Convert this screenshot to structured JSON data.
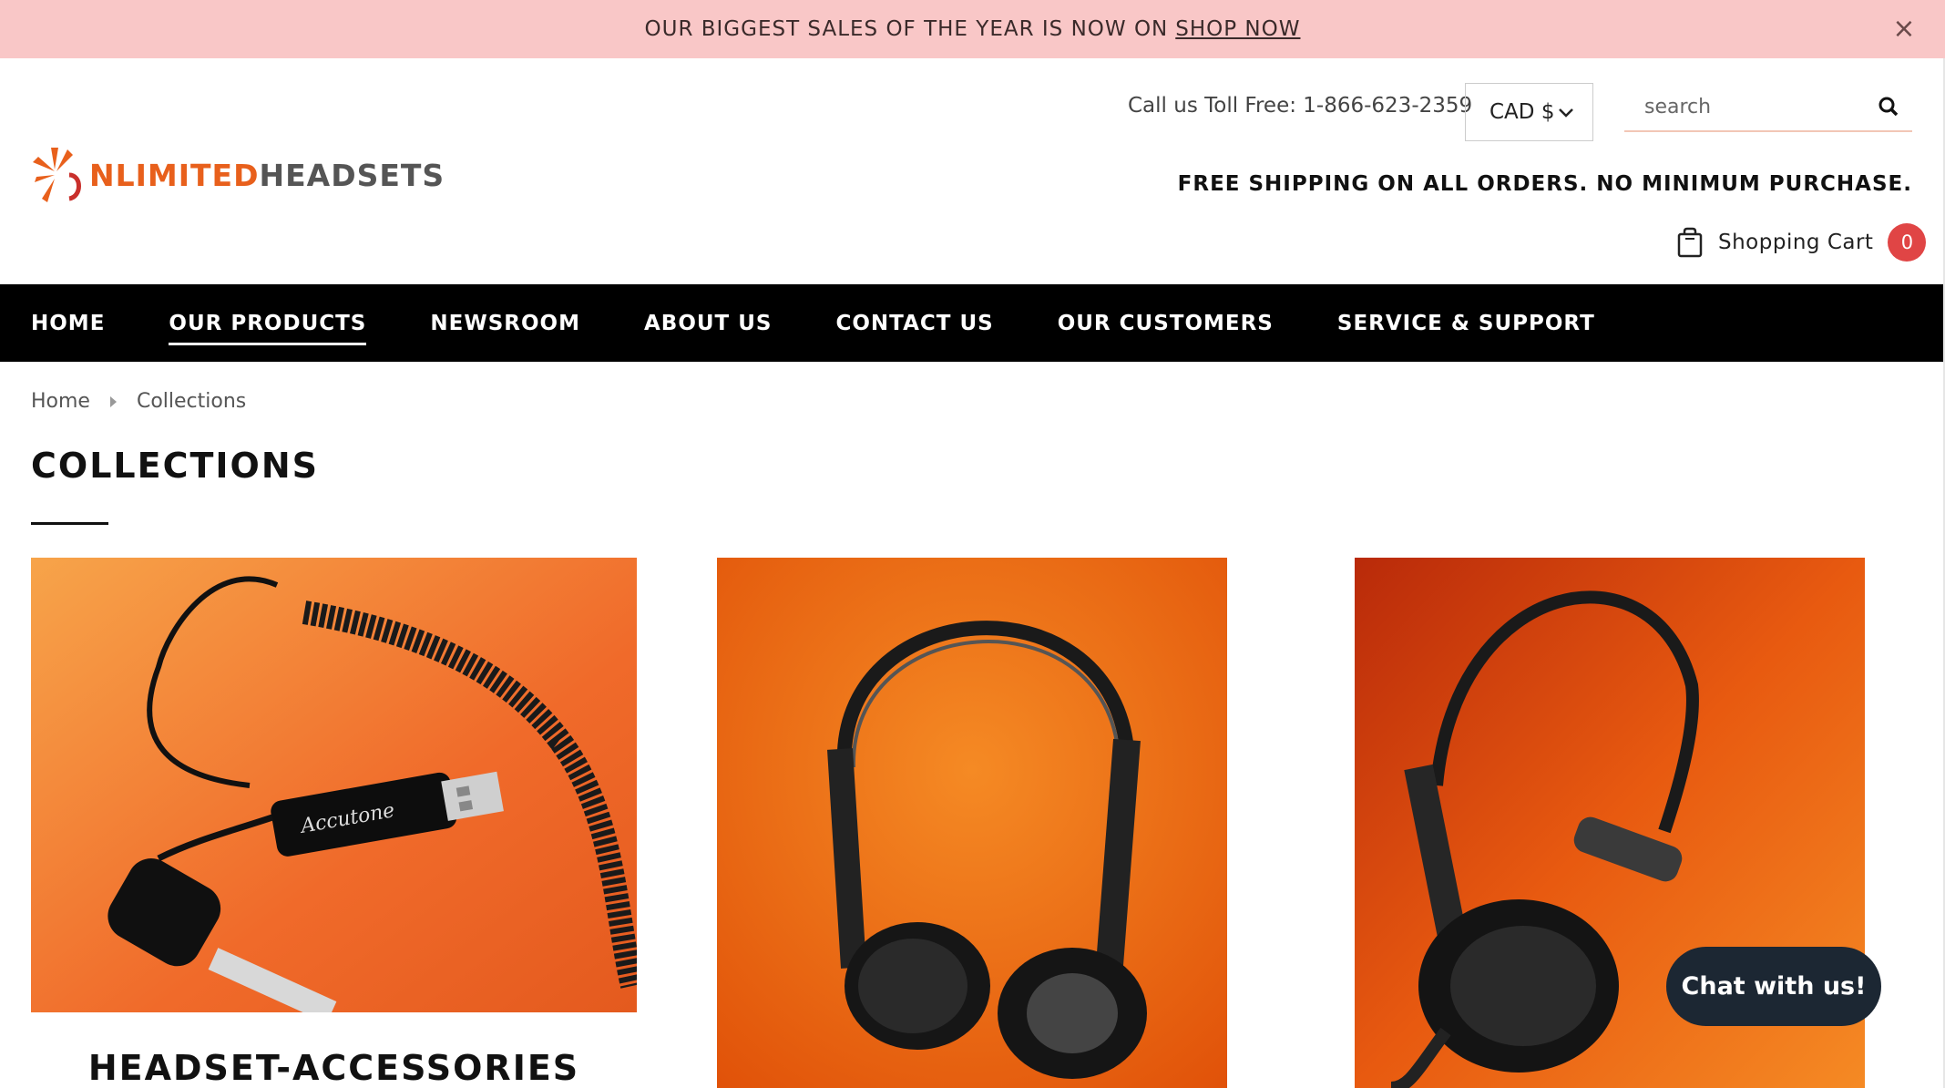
{
  "announcement": {
    "text": "OUR BIGGEST SALES OF THE YEAR IS NOW ON",
    "link": "SHOP NOW",
    "close": "×"
  },
  "header": {
    "logo_part1": "NLIMITED",
    "logo_part2": "HEADSETS",
    "tollfree": "Call us Toll Free: 1-866-623-2359",
    "currency": "CAD $",
    "search_placeholder": "search",
    "free_shipping": "FREE SHIPPING ON ALL ORDERS. NO MINIMUM PURCHASE.",
    "cart_label": "Shopping Cart",
    "cart_count": "0"
  },
  "nav": {
    "items": [
      {
        "label": "HOME"
      },
      {
        "label": "OUR PRODUCTS"
      },
      {
        "label": "NEWSROOM"
      },
      {
        "label": "ABOUT US"
      },
      {
        "label": "CONTACT US"
      },
      {
        "label": "OUR CUSTOMERS"
      },
      {
        "label": "SERVICE & SUPPORT"
      }
    ],
    "active": "OUR PRODUCTS"
  },
  "breadcrumb": {
    "home": "Home",
    "current": "Collections"
  },
  "page_title": "COLLECTIONS",
  "collections": [
    {
      "title": "HEADSET-ACCESSORIES",
      "brand": "Accutone"
    },
    {
      "title": ""
    },
    {
      "title": ""
    }
  ],
  "chat": {
    "label": "Chat with us!"
  },
  "colors": {
    "announcement_bg": "#f9c7c7",
    "nav_bg": "#000000",
    "accent": "#e8601c",
    "badge": "#e04545",
    "chat_bg": "#1c2733"
  }
}
